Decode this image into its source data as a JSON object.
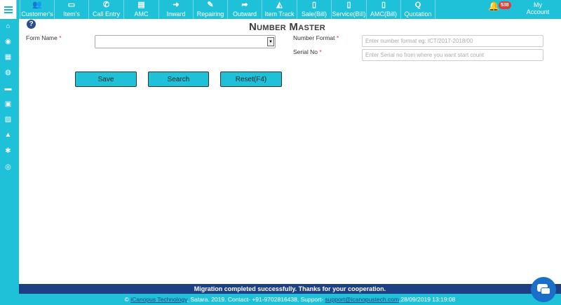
{
  "nav": {
    "items": [
      {
        "label": "Customer's",
        "icon": "customers-icon",
        "glyph": "👥"
      },
      {
        "label": "Item's",
        "icon": "laptop-icon",
        "glyph": "▭"
      },
      {
        "label": "Call Entry",
        "icon": "phone-icon",
        "glyph": "✆"
      },
      {
        "label": "AMC",
        "icon": "document-icon",
        "glyph": "▤"
      },
      {
        "label": "Inward",
        "icon": "sign-in-icon",
        "glyph": "➜"
      },
      {
        "label": "Repairing",
        "icon": "wrench-icon",
        "glyph": "✎"
      },
      {
        "label": "Outward",
        "icon": "share-icon",
        "glyph": "➦"
      },
      {
        "label": "Item Track",
        "icon": "area-chart-icon",
        "glyph": "◭"
      },
      {
        "label": "Sale(Bill)",
        "icon": "bill-icon",
        "glyph": "▯"
      },
      {
        "label": "Service(Bill)",
        "icon": "bill-icon",
        "glyph": "▯"
      },
      {
        "label": "AMC(Bill)",
        "icon": "bill-icon",
        "glyph": "▯"
      },
      {
        "label": "Quotation",
        "icon": "q-icon",
        "glyph": "Q"
      }
    ],
    "notification_count": "538",
    "account_label_line1": "My",
    "account_label_line2": "Account"
  },
  "sidebar": {
    "icons": [
      "home-icon",
      "globe-icon",
      "grid-icon",
      "globe-alt-icon",
      "book-icon",
      "store-icon",
      "image-icon",
      "chart-icon",
      "gear-icon",
      "life-ring-icon"
    ],
    "glyphs": [
      "⌂",
      "◉",
      "▦",
      "◍",
      "▬",
      "▣",
      "▨",
      "▲",
      "✱",
      "◎"
    ]
  },
  "form": {
    "help_glyph": "?",
    "title": "Number Master",
    "form_name_label": "Form Name",
    "form_name_value": "",
    "number_format_label": "Number Format",
    "number_format_placeholder": "Enter number format eg: ICT/2017-2018/00",
    "serial_no_label": "Serial No",
    "serial_no_placeholder": "Enter Serial no from where you want start count",
    "required_mark": "*",
    "buttons": {
      "save": "Save",
      "search": "Search",
      "reset": "Reset(F4)"
    }
  },
  "banner": "Migration completed successfully. Thanks for your cooperation.",
  "footer": {
    "copy": "© ",
    "company": "iCanopus Technology",
    "middle": ", Satara. 2019. Contact- +91-9702816438, Support- ",
    "email": "support@icanopustech.com",
    "datetime": ",28/09/2019 13:19:08"
  },
  "colors": {
    "accent": "#1fc1d8",
    "banner": "#1d3f85",
    "required": "#e53935"
  }
}
